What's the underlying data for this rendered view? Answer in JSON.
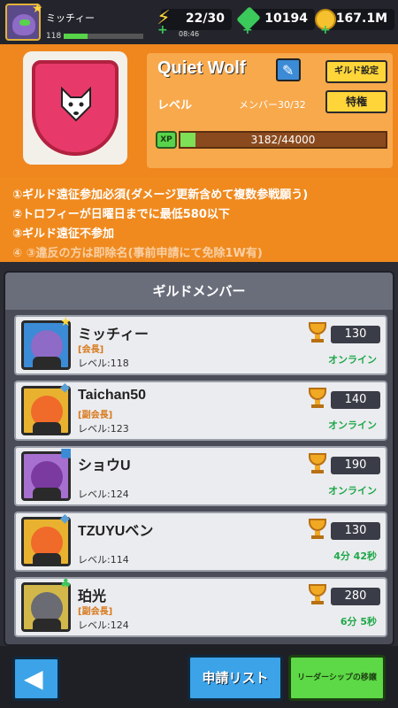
{
  "player": {
    "name": "ミッチィー",
    "level": "118"
  },
  "resources": {
    "energy": "22/30",
    "energy_timer": "08:46",
    "gems": "10194",
    "coins": "167.1M"
  },
  "guild": {
    "name": "Quiet Wolf",
    "settings_label": "ギルド設定",
    "level_label": "レベル",
    "member_count": "メンバー30/32",
    "perks_label": "特権",
    "xp_icon_label": "XP",
    "xp_text": "3182/44000",
    "xp_progress": 0.072,
    "emblem_color": "#e83a6a"
  },
  "notice": [
    "①ギルド遠征参加必須(ダメージ更新含めて複数参戦願う)",
    "②トロフィーが日曜日までに最低580以下",
    "③ギルド遠征不参加",
    "④ ③違反の方は即除名(事前申請にて免除1W有)"
  ],
  "members_title": "ギルドメンバー",
  "members": [
    {
      "name": "ミッチィー",
      "role": "[会長]",
      "level": "レベル:118",
      "trophies": "130",
      "status": "オンライン"
    },
    {
      "name": "Taichan50",
      "role": "[副会長]",
      "level": "レベル:123",
      "trophies": "140",
      "status": "オンライン"
    },
    {
      "name": "ショウU",
      "role": "",
      "level": "レベル:124",
      "trophies": "190",
      "status": "オンライン"
    },
    {
      "name": "TZUYUベン",
      "role": "",
      "level": "レベル:114",
      "trophies": "130",
      "status": "4分 42秒"
    },
    {
      "name": "珀光",
      "role": "[副会長]",
      "level": "レベル:124",
      "trophies": "280",
      "status": "6分 5秒"
    }
  ],
  "bottom": {
    "apply_list_label": "申請リスト",
    "transfer_label": "リーダーシップの移譲"
  },
  "colors": {
    "accent_orange": "#f0861e",
    "online_green": "#1fa84a",
    "button_blue": "#3ca3e8",
    "button_green": "#5dd846"
  }
}
